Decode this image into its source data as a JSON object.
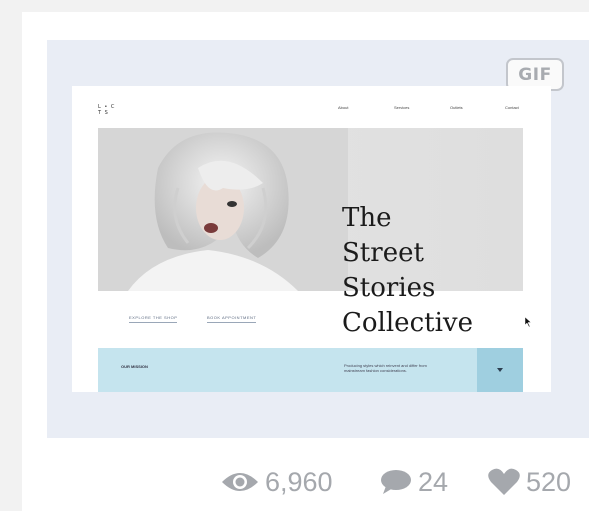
{
  "badge": {
    "label": "GIF"
  },
  "site": {
    "logo_lines": [
      "L  •  C",
      "   T    S"
    ],
    "nav": [
      "About",
      "Services",
      "Outlets",
      "Contact"
    ],
    "hero_title": "The\nStreet\nStories\nCollective",
    "links": [
      "EXPLORE THE SHOP",
      "BOOK APPOINTMENT"
    ],
    "mission_label": "OUR MISSION",
    "mission_text": "Producing styles which reinvent and differ from mainstream fashion considerations."
  },
  "stats": {
    "views": "6,960",
    "comments": "24",
    "likes": "520"
  },
  "colors": {
    "frame_bg": "#e9edf5",
    "mission_bg": "#c5e4ee",
    "stat_gray": "#a5a8ad"
  },
  "icons": [
    "eye-icon",
    "speech-bubble-icon",
    "heart-icon",
    "cursor-icon",
    "chevron-down-icon"
  ]
}
